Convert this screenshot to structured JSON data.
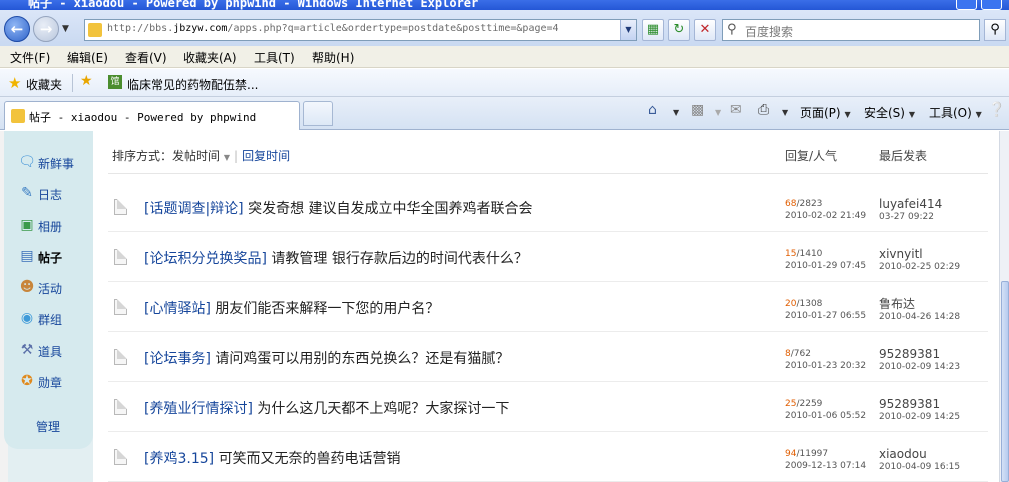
{
  "window": {
    "title": "帖子 - xiaodou - Powered by phpwind - Windows Internet Explorer"
  },
  "address": {
    "url_prefix": "http://bbs.",
    "url_domain": "jbzyw.com",
    "url_rest": "/apps.php?q=article&ordertype=postdate&posttime=&page=4",
    "search_placeholder": "百度搜索"
  },
  "menu": [
    "文件(F)",
    "编辑(E)",
    "查看(V)",
    "收藏夹(A)",
    "工具(T)",
    "帮助(H)"
  ],
  "favorites": {
    "label": "收藏夹",
    "item": "临床常见的药物配伍禁..."
  },
  "tab": {
    "title": "帖子 - xiaodou - Powered by phpwind"
  },
  "commandbar": {
    "page": "页面(P)",
    "safety": "安全(S)",
    "tools": "工具(O)"
  },
  "sidebar": {
    "items": [
      {
        "label": "新鲜事",
        "icon": "speech-bubble-icon"
      },
      {
        "label": "日志",
        "icon": "diary-icon"
      },
      {
        "label": "相册",
        "icon": "photo-album-icon"
      },
      {
        "label": "帖子",
        "icon": "post-document-icon"
      },
      {
        "label": "活动",
        "icon": "people-icon"
      },
      {
        "label": "群组",
        "icon": "group-bubble-icon"
      },
      {
        "label": "道具",
        "icon": "tool-icon"
      },
      {
        "label": "勋章",
        "icon": "medal-icon"
      }
    ],
    "manage": "管理",
    "active_index": 3
  },
  "sort": {
    "label": "排序方式：",
    "active": "发帖时间",
    "other": "回复时间"
  },
  "columns": {
    "replies_views": "回复/人气",
    "last_post": "最后发表"
  },
  "posts": [
    {
      "category": "[话题调查|辩论]",
      "title": "突发奇想 建议自发成立中华全国养鸡者联合会",
      "replies": "68",
      "views": "/2823",
      "posted": "2010-02-02 21:49",
      "last_user": "luyafei414",
      "last_time": "03-27 09:22"
    },
    {
      "category": "[论坛积分兑换奖品]",
      "title": "请教管理 银行存款后边的时间代表什么？",
      "replies": "15",
      "views": "/1410",
      "posted": "2010-01-29 07:45",
      "last_user": "xivnyitl",
      "last_time": "2010-02-25 02:29"
    },
    {
      "category": "[心情驿站]",
      "title": "朋友们能否来解释一下您的用户名？",
      "replies": "20",
      "views": "/1308",
      "posted": "2010-01-27 06:55",
      "last_user": "鲁布达",
      "last_time": "2010-04-26 14:28"
    },
    {
      "category": "[论坛事务]",
      "title": "请问鸡蛋可以用别的东西兑换么？还是有猫腻？",
      "replies": "8",
      "views": "/762",
      "posted": "2010-01-23 20:32",
      "last_user": "95289381",
      "last_time": "2010-02-09 14:23"
    },
    {
      "category": "[养殖业行情探讨]",
      "title": "为什么这几天都不上鸡呢？大家探讨一下",
      "replies": "25",
      "views": "/2259",
      "posted": "2010-01-06 05:52",
      "last_user": "95289381",
      "last_time": "2010-02-09 14:25"
    },
    {
      "category": "[养鸡3.15]",
      "title": "可笑而又无奈的兽药电话营销",
      "replies": "94",
      "views": "/11997",
      "posted": "2009-12-13 07:14",
      "last_user": "xiaodou",
      "last_time": "2010-04-09 16:15"
    }
  ]
}
